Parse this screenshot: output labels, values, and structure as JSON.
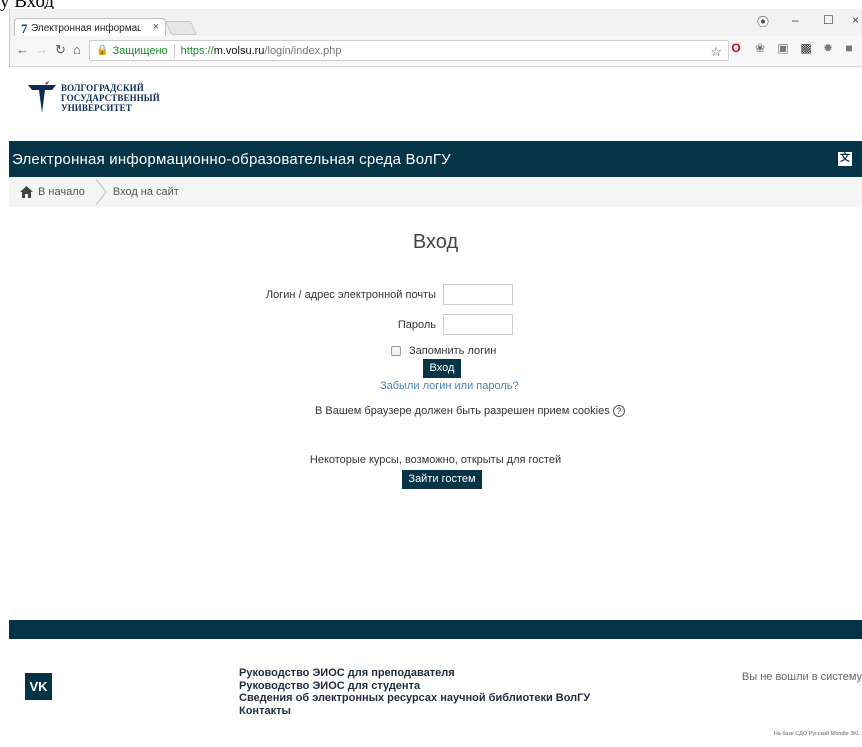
{
  "caption": "у Вход",
  "browser": {
    "tab_title": "Электронная информац...",
    "tab_close": "×",
    "secure_label": "Защищено",
    "url_scheme": "https://",
    "url_host": "m.volsu.ru",
    "url_path": "/login/index.php",
    "profile_icon": "⦿",
    "minimize": "–",
    "maximize": "☐",
    "close": "×"
  },
  "logo": {
    "line1": "ВОЛГОГРАДСКИЙ",
    "line2": "ГОСУДАРСТВЕННЫЙ",
    "line3": "УНИВЕРСИТЕТ"
  },
  "header": {
    "site_title": "Электронная информационно-образовательная среда ВолГУ",
    "lang_icon": "文A"
  },
  "breadcrumb": {
    "home": "В начало",
    "current": "Вход на сайт"
  },
  "login": {
    "title": "Вход",
    "username_label": "Логин / адрес электронной почты",
    "username_value": "",
    "password_label": "Пароль",
    "password_value": "",
    "remember_label": "Запомнить логин",
    "submit_label": "Вход",
    "forgot_link": "Забыли логин или пароль?",
    "cookies_text": "В Вашем браузере должен быть разрешен прием cookies",
    "guest_text": "Некоторые курсы, возможно, открыты для гостей",
    "guest_button": "Зайти гостем"
  },
  "footer": {
    "vk_label": "VK",
    "links": [
      "Руководство ЭИОС для преподавателя",
      "Руководство ЭИОС для студента",
      "Сведения об электронных ресурсах научной библиотеки ВолГУ",
      "Контакты"
    ],
    "login_status": "Вы не вошли в систему",
    "powered_by": "На базе СДО Русский Moodle 3KL"
  },
  "colors": {
    "brand_dark": "#063447",
    "link": "#4a82b5"
  }
}
